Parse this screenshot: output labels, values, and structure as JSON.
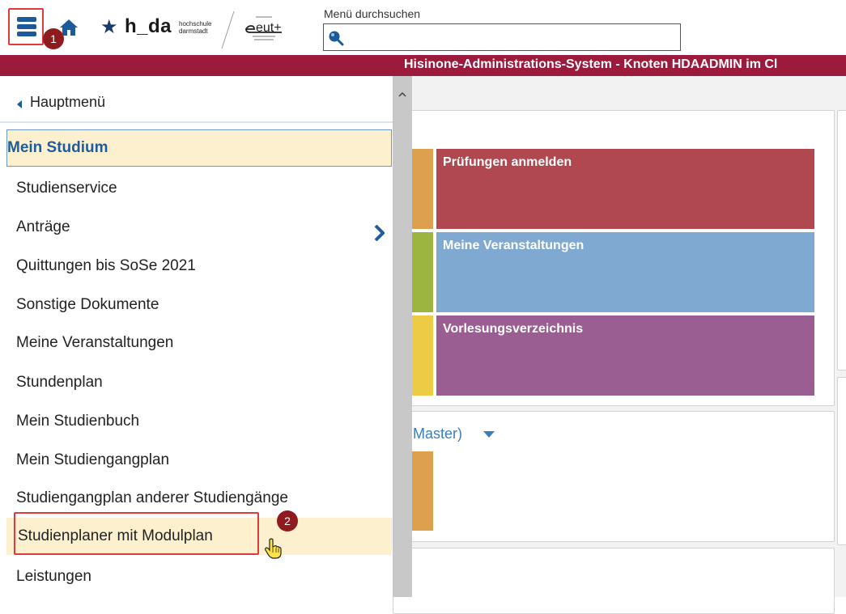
{
  "header": {
    "logo_text": "h_da",
    "logo_subtext_1": "hochschule",
    "logo_subtext_2": "darmstadt",
    "partner_logo_text": "eut+",
    "search_label": "Menü durchsuchen",
    "search_value": "",
    "icons": [
      "menu-icon",
      "home-icon",
      "star-icon",
      "search-icon"
    ]
  },
  "titlebar": {
    "text": "Hisinone-Administrations-System - Knoten HDAADMIN im Cl"
  },
  "sidemenu": {
    "back_label": "Hauptmenü",
    "items": [
      {
        "label": "Mein Studium",
        "state": "active"
      },
      {
        "label": "Studienservice"
      },
      {
        "label": "Anträge",
        "has_submenu": true
      },
      {
        "label": "Quittungen bis SoSe 2021"
      },
      {
        "label": "Sonstige Dokumente"
      },
      {
        "label": "Meine Veranstaltungen"
      },
      {
        "label": "Stundenplan"
      },
      {
        "label": "Mein Studienbuch"
      },
      {
        "label": "Mein Studiengangplan"
      },
      {
        "label": "Studiengangplan anderer Studiengänge"
      },
      {
        "label": "Studienplaner mit Modulplan",
        "state": "hover"
      },
      {
        "label": "Leistungen"
      }
    ]
  },
  "dashboard": {
    "tiles": [
      {
        "label": "Prüfungen anmelden",
        "color": "#b0484f"
      },
      {
        "label": "Meine Veranstaltungen",
        "color": "#7fa9d0"
      },
      {
        "label": "Vorlesungsverzeichnis",
        "color": "#9a5e92"
      }
    ],
    "side_colors": [
      "#dca04f",
      "#9cb440",
      "#eecb44"
    ],
    "master_link": "Master)"
  },
  "annotations": {
    "badge_1": "1",
    "badge_2": "2",
    "color": "#e0393e"
  },
  "colors": {
    "titlebar": "#9c1b3c",
    "accent": "#1f5c99",
    "active_bg": "#fdf0cf"
  }
}
